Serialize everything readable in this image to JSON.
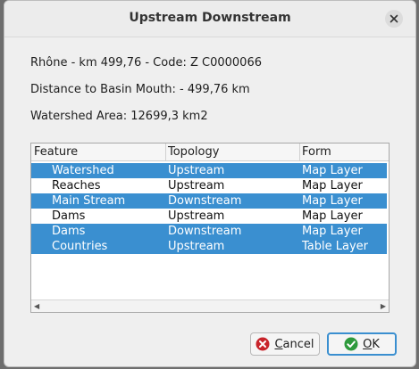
{
  "dialog": {
    "title": "Upstream Downstream"
  },
  "info": {
    "line1": "Rhône - km 499,76 - Code: Z  C0000066",
    "line2": "Distance to Basin Mouth: - 499,76 km",
    "line3": "Watershed Area: 12699,3 km2"
  },
  "table": {
    "headers": [
      "Feature",
      "Topology",
      "Form"
    ],
    "rows": [
      {
        "feature": "Watershed",
        "topology": "Upstream",
        "form": "Map Layer",
        "selected": true
      },
      {
        "feature": "Reaches",
        "topology": "Upstream",
        "form": "Map Layer",
        "selected": false
      },
      {
        "feature": "Main Stream",
        "topology": "Downstream",
        "form": "Map Layer",
        "selected": true
      },
      {
        "feature": "Dams",
        "topology": "Upstream",
        "form": "Map Layer",
        "selected": false
      },
      {
        "feature": "Dams",
        "topology": "Downstream",
        "form": "Map Layer",
        "selected": true
      },
      {
        "feature": "Countries",
        "topology": "Upstream",
        "form": "Table Layer",
        "selected": true
      }
    ]
  },
  "buttons": {
    "cancel_mnemonic": "C",
    "cancel_rest": "ancel",
    "ok_mnemonic": "O",
    "ok_rest": "K"
  },
  "colors": {
    "selection": "#3a8fd0",
    "cancel_icon": "#c8242b",
    "ok_icon": "#2e9a3c"
  },
  "icons": {
    "close": "close-icon",
    "cancel": "cancel-icon",
    "ok": "check-icon",
    "scroll_left": "chevron-left-icon",
    "scroll_right": "chevron-right-icon"
  }
}
